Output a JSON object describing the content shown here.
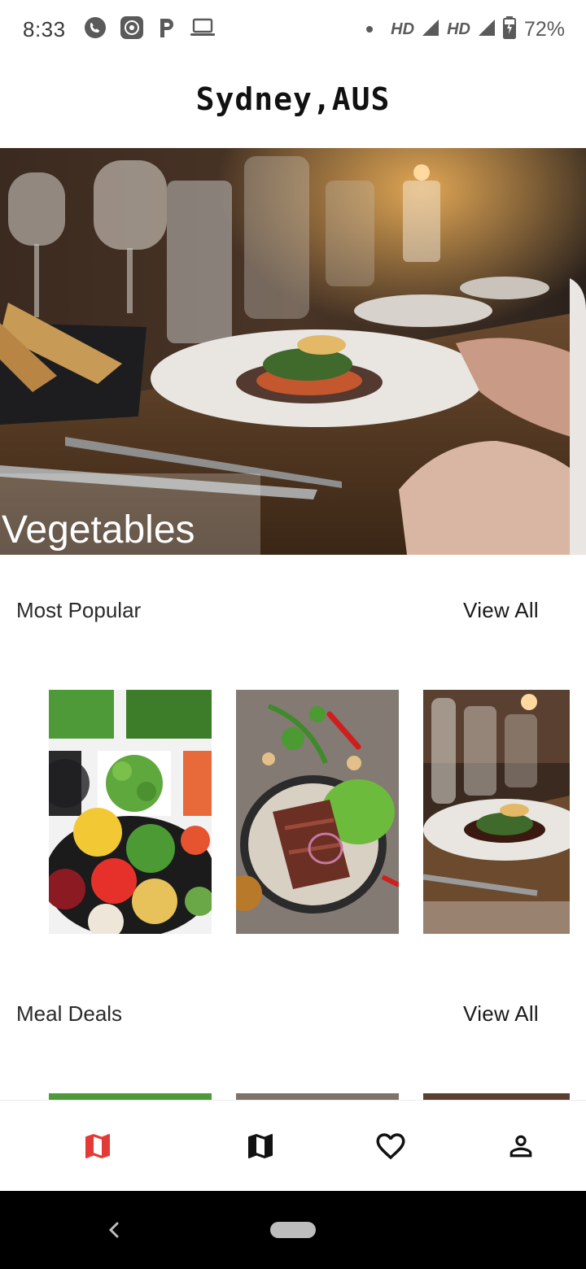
{
  "status_bar": {
    "time": "8:33",
    "icons_left": [
      "phone-icon",
      "screen-record-icon",
      "parking-icon",
      "laptop-icon"
    ],
    "network_1": "HD",
    "network_2": "HD",
    "battery": "72%"
  },
  "header": {
    "title": "Sydney,AUS"
  },
  "hero": {
    "caption": "Vegetables"
  },
  "sections": [
    {
      "title": "Most Popular",
      "action": "View All"
    },
    {
      "title": "Meal Deals",
      "action": "View All"
    }
  ],
  "bottom_nav": {
    "items": [
      "map-icon",
      "map-icon",
      "heart-icon",
      "person-icon"
    ],
    "active_index": 0,
    "active_color": "#E53935"
  },
  "colors": {
    "accent": "#E53935",
    "text": "#1f1f1f"
  }
}
